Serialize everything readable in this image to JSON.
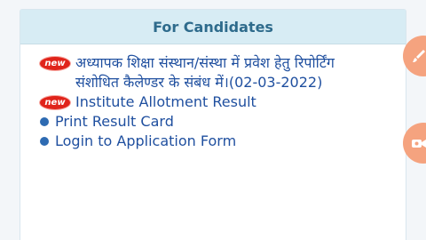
{
  "card": {
    "title": "For Candidates"
  },
  "items": [
    {
      "badge": "new",
      "text": "अध्यापक शिक्षा संस्थान/संस्था में प्रवेश हेतु रिपोर्टिंग संशोधित कैलेण्डर के संबंध में।(02-03-2022)"
    },
    {
      "badge": "new",
      "text": "Institute Allotment Result"
    },
    {
      "text": "Print Result Card"
    },
    {
      "text": "Login to Application Form"
    }
  ],
  "colors": {
    "header_bg": "#d7ecf4",
    "title": "#2e6b8c",
    "link": "#1f4f9f",
    "badge": "#e0241b",
    "bullet": "#2e6bb2",
    "fab": "#f5a37f"
  },
  "icons": {
    "fab_top": "paintbrush-icon",
    "fab_bottom": "video-camera-icon"
  }
}
